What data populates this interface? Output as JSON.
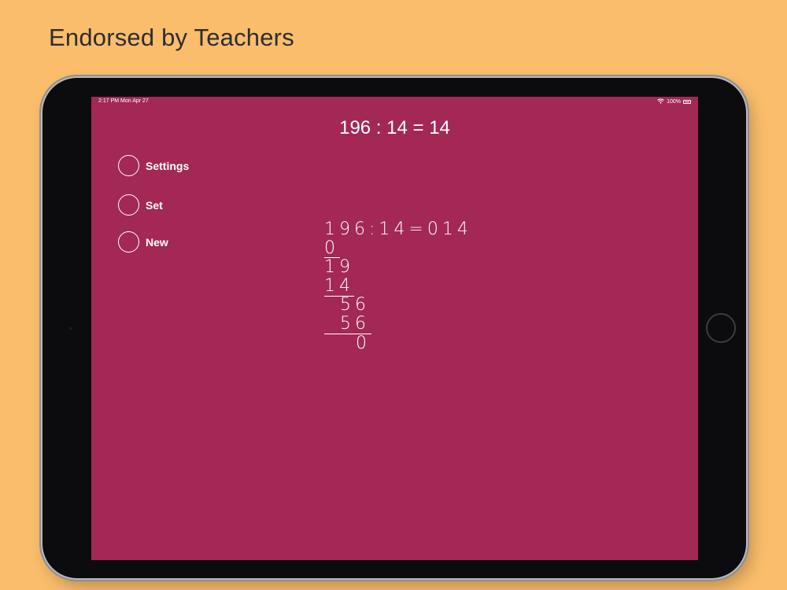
{
  "headline": "Endorsed by Teachers",
  "status_bar": {
    "time": "2:17 PM   Mon Apr 27",
    "wifi": "wifi-icon",
    "battery_text": "100%"
  },
  "equation": "196 : 14 = 14",
  "menu": [
    {
      "label": "Settings"
    },
    {
      "label": "Set"
    },
    {
      "label": "New"
    }
  ],
  "long_division": {
    "header": "196:14=014",
    "rows": [
      "0",
      "19",
      "14",
      "56",
      "56",
      "0"
    ]
  },
  "colors": {
    "background": "#F9BD6B",
    "screen": "#A32855",
    "text": "#FFFFFF"
  }
}
